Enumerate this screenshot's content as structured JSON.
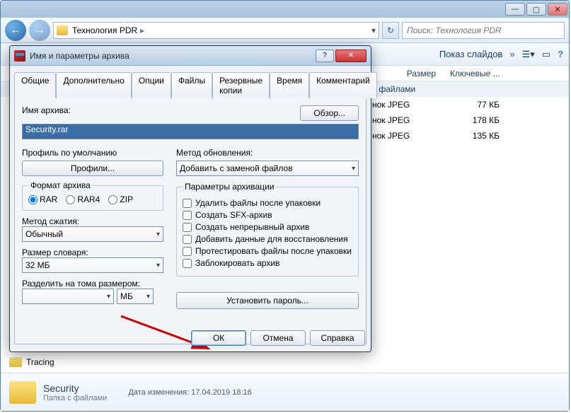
{
  "explorer": {
    "breadcrumb": "Технология PDR",
    "search_placeholder": "Поиск: Технология PDR",
    "toolbar": {
      "slideshow": "Показ слайдов"
    },
    "columns": {
      "size": "Размер",
      "keywords": "Ключевые ..."
    },
    "group_label": "с файлами",
    "rows": [
      {
        "type_suffix": "нок JPEG",
        "size": "77 КБ"
      },
      {
        "type_suffix": "нок JPEG",
        "size": "178 КБ"
      },
      {
        "type_suffix": "нок JPEG",
        "size": "135 КБ"
      }
    ],
    "sidebar_item": "Tracing",
    "details": {
      "name": "Security",
      "type": "Папка с файлами",
      "date_label": "Дата изменения:",
      "date_value": "17.04.2019 18:16"
    }
  },
  "dialog": {
    "title": "Имя и параметры архива",
    "tabs": [
      "Общие",
      "Дополнительно",
      "Опции",
      "Файлы",
      "Резервные копии",
      "Время",
      "Комментарий"
    ],
    "archive_name_label": "Имя архива:",
    "archive_name_value": "Security.rar",
    "browse": "Обзор...",
    "default_profile_label": "Профиль по умолчанию",
    "profiles_btn": "Профили...",
    "update_method_label": "Метод обновления:",
    "update_method_value": "Добавить с заменой файлов",
    "format_label": "Формат архива",
    "formats": [
      "RAR",
      "RAR4",
      "ZIP"
    ],
    "compress_label": "Метод сжатия:",
    "compress_value": "Обычный",
    "dict_label": "Размер словаря:",
    "dict_value": "32 МБ",
    "volume_label": "Разделить на тома размером:",
    "volume_unit": "МБ",
    "params_label": "Параметры архивации",
    "checks": [
      "Удалить файлы после упаковки",
      "Создать SFX-архив",
      "Создать непрерывный архив",
      "Добавить данные для восстановления",
      "Протестировать файлы после упаковки",
      "Заблокировать архив"
    ],
    "set_password": "Установить пароль...",
    "ok": "ОК",
    "cancel": "Отмена",
    "help": "Справка"
  }
}
